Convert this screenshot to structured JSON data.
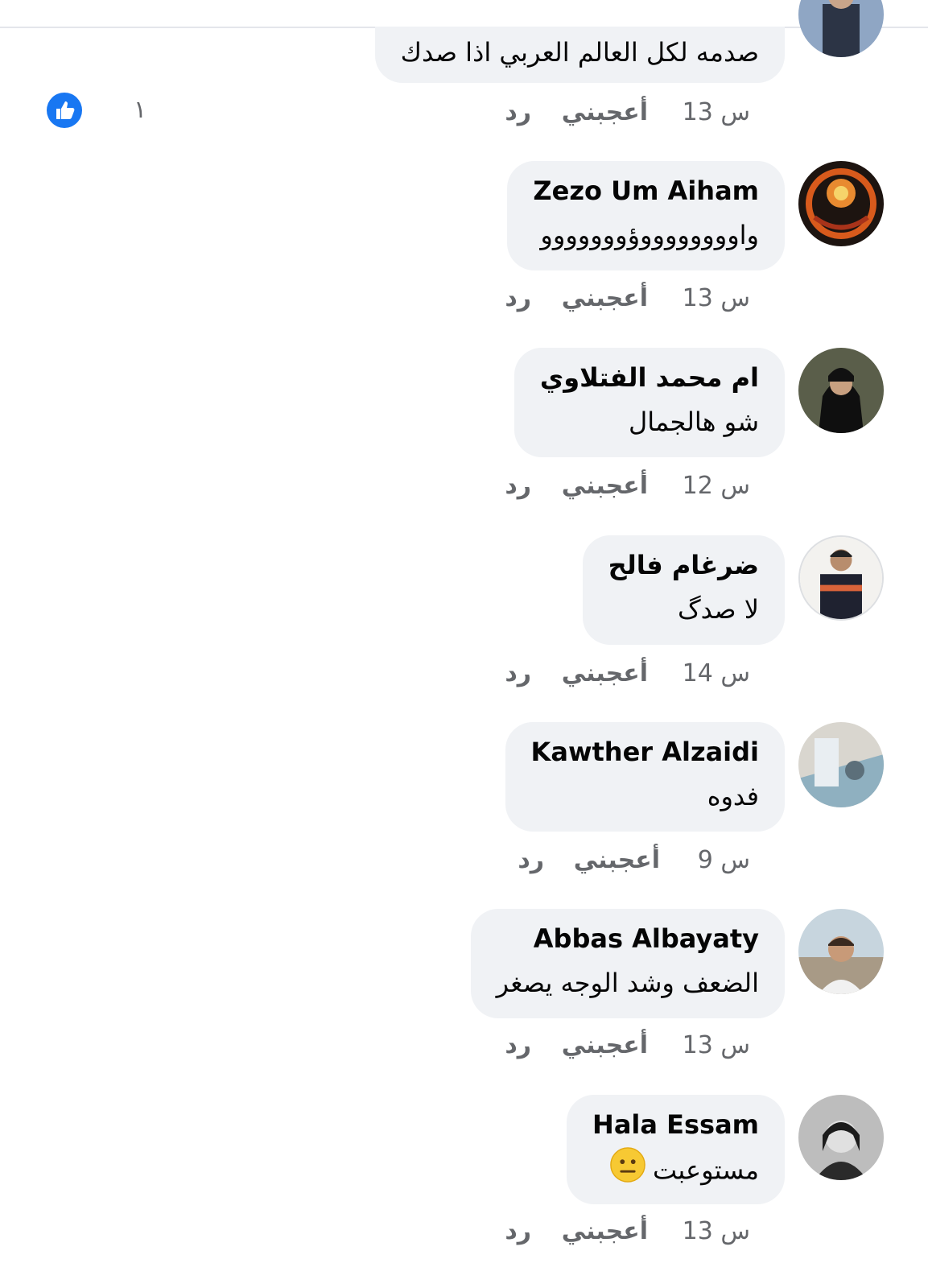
{
  "labels": {
    "like": "أعجبني",
    "reply": "رد"
  },
  "colors": {
    "bubble": "#f0f2f5",
    "meta_text": "#65676b",
    "like_blue": "#1877f2",
    "page_bg": "#ffffff"
  },
  "comments": [
    {
      "author": "",
      "text": "صدمه لكل العالم العربي اذا صدك",
      "time": "13 س",
      "reactions": {
        "icon": "like-icon",
        "count": "١"
      }
    },
    {
      "author": "Zezo Um Aiham",
      "text": "واووووووووؤووووووو",
      "time": "13 س"
    },
    {
      "author": "ام محمد الفتلاوي",
      "text": "شو هالجمال",
      "time": "12 س"
    },
    {
      "author": "ضرغام فالح",
      "text": "لا صدگ",
      "time": "14 س"
    },
    {
      "author": "Kawther Alzaidi",
      "text": "فدوه",
      "time": "9 س"
    },
    {
      "author": "Abbas Albayaty",
      "text": "الضعف وشد الوجه يصغر",
      "time": "13 س"
    },
    {
      "author": "Hala Essam",
      "text": "مستوعبت",
      "emoji": "neutral-face-emoji",
      "time": "13 س"
    }
  ]
}
